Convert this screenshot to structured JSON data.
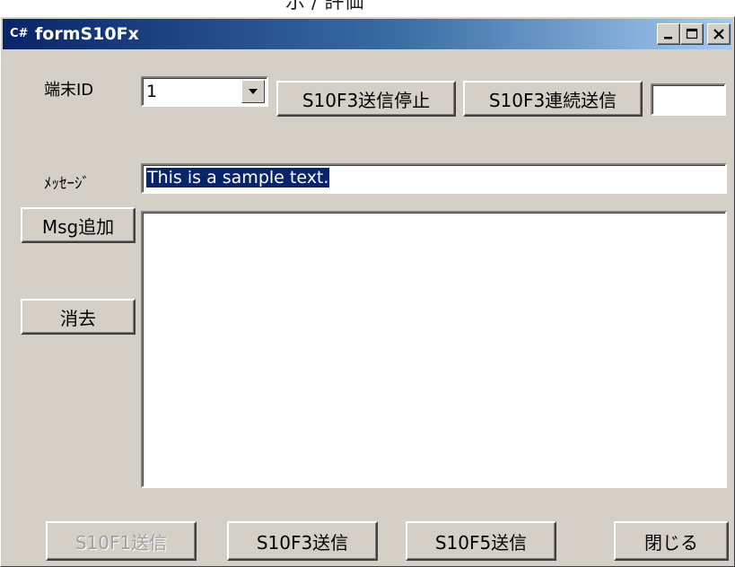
{
  "caption_fragment": "示 / 評価",
  "window": {
    "title": "formS10Fx",
    "icon_label": "C#",
    "icons": {
      "app": "csharp-app-icon",
      "minimize": "minimize-icon",
      "maximize": "maximize-icon",
      "close": "close-icon",
      "dropdown": "dropdown-arrow-icon"
    },
    "colors": {
      "titlebar_start": "#0a246a",
      "titlebar_end": "#a6caf0",
      "face": "#d4d0c8",
      "selection": "#0a246a"
    }
  },
  "form": {
    "terminal_id_label": "端末ID",
    "terminal_id_value": "1",
    "stop_button": "S10F3送信停止",
    "continuous_button": "S10F3連続送信",
    "counter_value": "",
    "message_label": "ﾒｯｾｰｼﾞ",
    "message_value": "This is a sample text.",
    "add_msg_button": "Msg追加",
    "clear_button": "消去",
    "log_text": ""
  },
  "footer": {
    "s10f1_button": "S10F1送信",
    "s10f3_button": "S10F3送信",
    "s10f5_button": "S10F5送信",
    "close_button": "閉じる"
  }
}
